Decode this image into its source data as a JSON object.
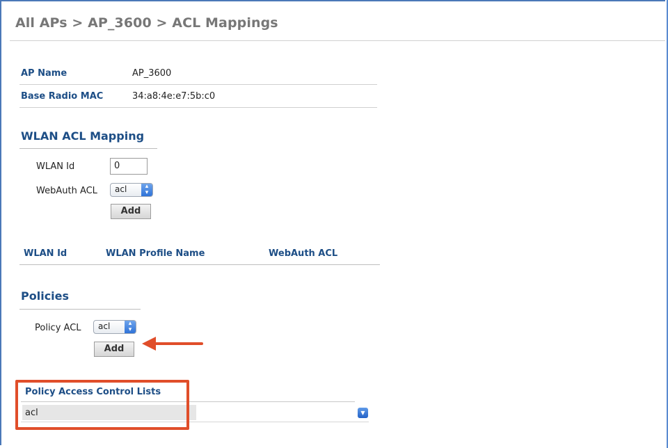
{
  "breadcrumb": "All APs > AP_3600 > ACL Mappings",
  "ap_info": {
    "ap_name_label": "AP Name",
    "ap_name_value": "AP_3600",
    "base_mac_label": "Base Radio MAC",
    "base_mac_value": "34:a8:4e:e7:5b:c0"
  },
  "wlan_section": {
    "title": "WLAN ACL Mapping",
    "wlan_id_label": "WLAN Id",
    "wlan_id_value": "0",
    "webauth_label": "WebAuth ACL",
    "webauth_selected": "acl",
    "add_label": "Add",
    "columns": [
      "WLAN Id",
      "WLAN Profile Name",
      "WebAuth ACL"
    ]
  },
  "policies": {
    "title": "Policies",
    "policy_acl_label": "Policy ACL",
    "policy_acl_selected": "acl",
    "add_label": "Add"
  },
  "policy_list": {
    "title": "Policy Access Control Lists",
    "items": [
      "acl"
    ]
  },
  "icons": {
    "select_arrows": "up-down-chevron-icon",
    "dropdown": "chevron-down-icon",
    "callout_arrow": "red-arrow-icon"
  },
  "colors": {
    "heading": "#1d4e86",
    "highlight": "#e04e2a",
    "select_accent": "#2f73d8"
  }
}
